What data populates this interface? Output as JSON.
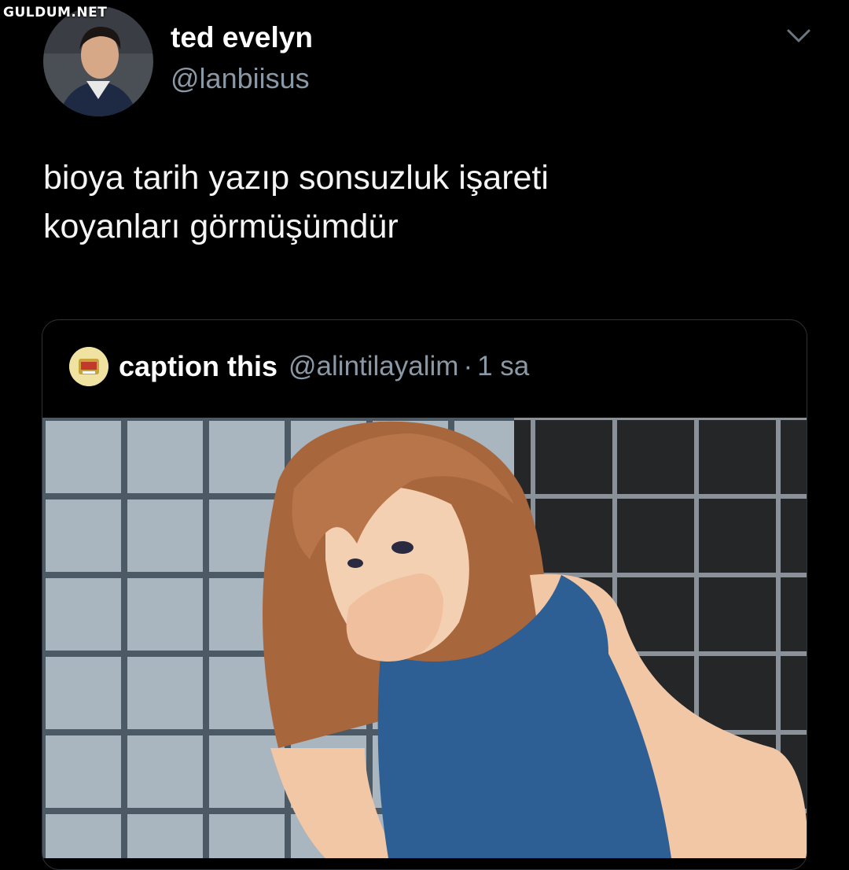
{
  "watermark": "GULDUM.NET",
  "tweet": {
    "author_name": "ted evelyn",
    "author_handle": "@lanbiisus",
    "text_line1": "bioya tarih yazıp sonsuzluk işareti",
    "text_line2": "koyanları görmüşümdür"
  },
  "quoted_tweet": {
    "author_name": "caption this",
    "author_handle": "@alintilayalim",
    "separator": "·",
    "time": "1 sa"
  },
  "icons": {
    "menu": "chevron-down-icon",
    "avatar": "avatar",
    "quoted_avatar": "quoted-avatar"
  },
  "colors": {
    "background": "#000000",
    "text_primary": "#ffffff",
    "text_secondary": "#8b98a5",
    "border": "#2f3336"
  }
}
